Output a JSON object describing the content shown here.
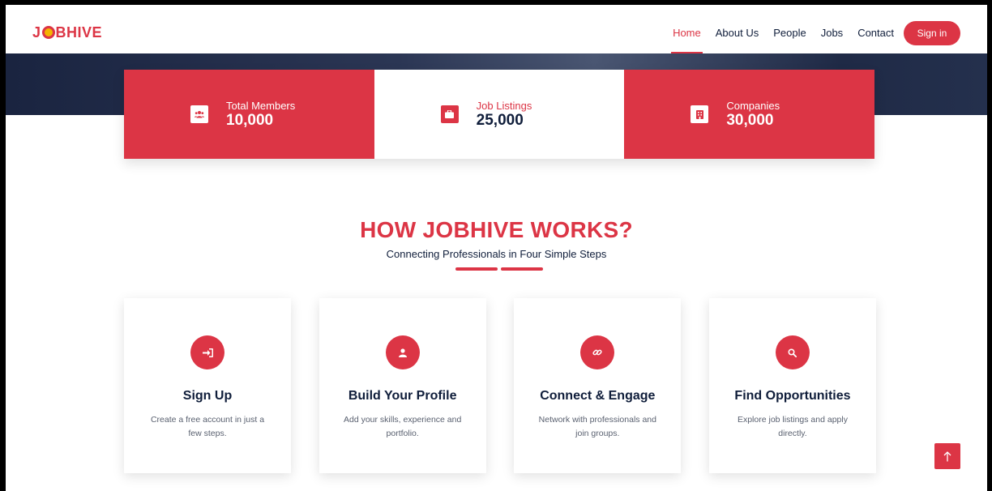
{
  "header": {
    "logo": {
      "prefix": "J",
      "suffix": "BHIVE"
    },
    "nav": [
      "Home",
      "About Us",
      "People",
      "Jobs",
      "Contact"
    ],
    "signin_label": "Sign in"
  },
  "stats": [
    {
      "label": "Total Members",
      "value": "10,000",
      "icon": "users-icon"
    },
    {
      "label": "Job Listings",
      "value": "25,000",
      "icon": "briefcase-icon"
    },
    {
      "label": "Companies",
      "value": "30,000",
      "icon": "building-icon"
    }
  ],
  "section": {
    "title": "HOW JOBHIVE WORKS?",
    "subtitle": "Connecting Professionals in Four Simple Steps"
  },
  "steps": [
    {
      "title": "Sign Up",
      "desc": "Create a free account in just a few steps.",
      "icon": "sign-in-icon"
    },
    {
      "title": "Build Your Profile",
      "desc": "Add your skills, experience and portfolio.",
      "icon": "user-icon"
    },
    {
      "title": "Connect & Engage",
      "desc": "Network with professionals and join groups.",
      "icon": "link-icon"
    },
    {
      "title": "Find Opportunities",
      "desc": "Explore job listings and apply directly.",
      "icon": "search-icon"
    }
  ],
  "colors": {
    "accent": "#dc3545",
    "navy": "#0f1d3a"
  }
}
